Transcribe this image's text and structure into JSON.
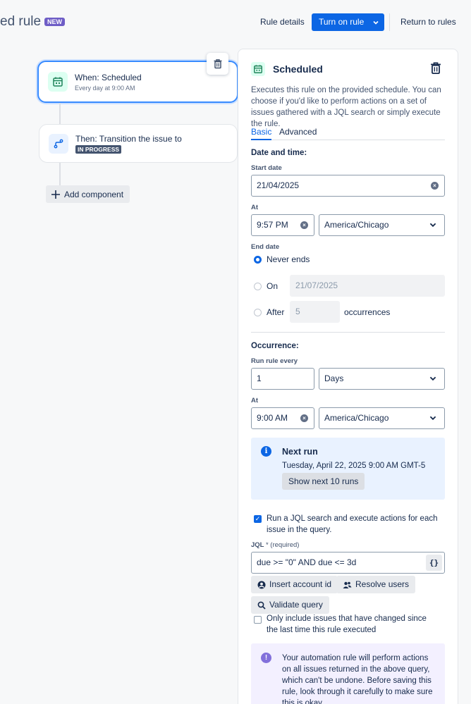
{
  "header": {
    "title": "ed rule",
    "badge": "NEW",
    "rule_details": "Rule details",
    "turn_on": "Turn on rule",
    "return": "Return to rules"
  },
  "canvas": {
    "trigger": {
      "title": "When: Scheduled",
      "subtitle": "Every day at 9:00 AM"
    },
    "action": {
      "title": "Then: Transition the issue to",
      "status": "IN PROGRESS"
    },
    "add_component": "Add component"
  },
  "panel": {
    "title": "Scheduled",
    "description": "Executes this rule on the provided schedule. You can choose if you'd like to perform actions on a set of issues gathered with a JQL search or simply execute the rule.",
    "tabs": [
      "Basic",
      "Advanced"
    ],
    "date_time_heading": "Date and time:",
    "start_date_label": "Start date",
    "start_date_value": "21/04/2025",
    "at_label": "At",
    "start_time_value": "9:57 PM",
    "timezone_value": "America/Chicago",
    "end_date_label": "End date",
    "end_options": {
      "never": "Never ends",
      "on": "On",
      "on_value": "21/07/2025",
      "after": "After",
      "after_value": "5",
      "occurrences": "occurrences"
    },
    "occurrence_heading": "Occurrence:",
    "run_every_label": "Run rule every",
    "run_every_value": "1",
    "unit_value": "Days",
    "at2_label": "At",
    "run_time_value": "9:00 AM",
    "timezone2_value": "America/Chicago",
    "next_run": {
      "title": "Next run",
      "value": "Tuesday, April 22, 2025 9:00 AM GMT-5",
      "button": "Show next 10 runs"
    },
    "jql_checkbox_label": "Run a JQL search and execute actions for each issue in the query.",
    "jql_label": "JQL",
    "jql_required": "* (required)",
    "jql_value": "due >= \"0\" AND due <= 3d",
    "insert_account": "Insert account id",
    "resolve_users": "Resolve users",
    "validate_query": "Validate query",
    "only_changed_label": "Only include issues that have changed since the last time this rule executed",
    "warning": "Your automation rule will perform actions on all issues returned in the above query, which can't be undone. Before saving this rule, look through it carefully to make sure this is okay."
  }
}
